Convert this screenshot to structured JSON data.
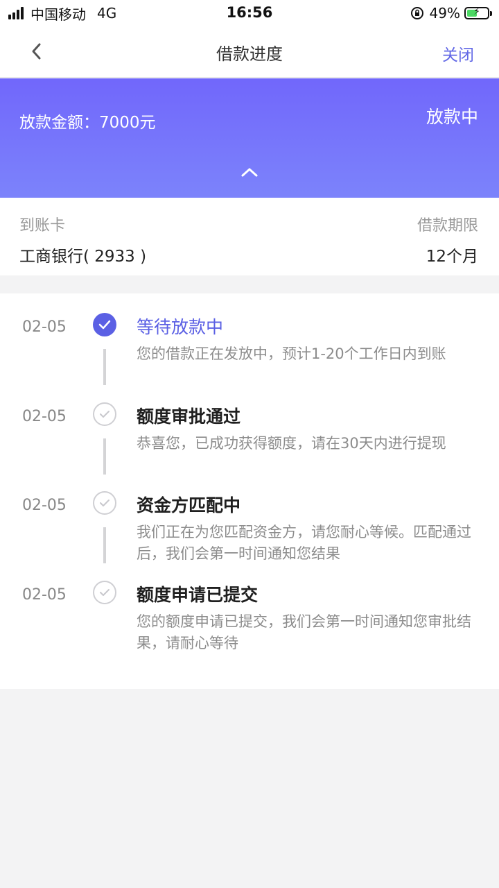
{
  "status_bar": {
    "carrier": "中国移动",
    "network": "4G",
    "time": "16:56",
    "battery": "49%",
    "battery_level": 0.49
  },
  "navbar": {
    "title": "借款进度",
    "close_label": "关闭"
  },
  "banner": {
    "amount_text": "放款金额：7000元",
    "status": "放款中"
  },
  "info": {
    "card_label": "到账卡",
    "card_value": "工商银行( 2933 )",
    "term_label": "借款期限",
    "term_value": "12个月"
  },
  "timeline": [
    {
      "date": "02-05",
      "title": "等待放款中",
      "desc": "您的借款正在发放中，预计1-20个工作日内到账",
      "state": "active"
    },
    {
      "date": "02-05",
      "title": "额度审批通过",
      "desc": "恭喜您，已成功获得额度，请在30天内进行提现",
      "state": "done"
    },
    {
      "date": "02-05",
      "title": "资金方匹配中",
      "desc": "我们正在为您匹配资金方，请您耐心等候。匹配通过后，我们会第一时间通知您结果",
      "state": "done"
    },
    {
      "date": "02-05",
      "title": "额度申请已提交",
      "desc": "您的额度申请已提交，我们会第一时间通知您审批结果，请耐心等待",
      "state": "done"
    }
  ],
  "colors": {
    "accent": "#5b60e4",
    "banner_top": "#7167fb",
    "banner_bottom": "#7c83fb"
  }
}
